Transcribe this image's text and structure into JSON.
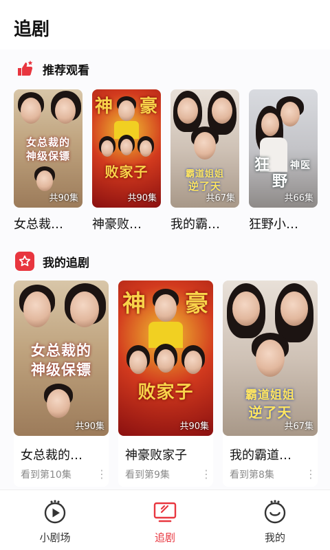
{
  "page": {
    "title": "追剧"
  },
  "recommend": {
    "title": "推荐观看",
    "items": [
      {
        "name": "女总裁…",
        "poster_title_1": "女总裁的",
        "poster_title_2": "神级保镖",
        "count": "共90集"
      },
      {
        "name": "神豪败…",
        "poster_title_1": "神",
        "poster_title_2": "豪",
        "poster_title_3": "败家子",
        "count": "共90集"
      },
      {
        "name": "我的霸…",
        "poster_title_1": "霸道姐姐",
        "poster_title_2": "逆了天",
        "count": "共67集"
      },
      {
        "name": "狂野小…",
        "poster_title_1": "狂",
        "poster_title_2": "野",
        "poster_title_3": "神医",
        "count": "共66集"
      }
    ]
  },
  "my_dramas": {
    "title": "我的追剧",
    "items": [
      {
        "name": "女总裁的…",
        "progress": "看到第10集",
        "poster_title_1": "女总裁的",
        "poster_title_2": "神级保镖",
        "count": "共90集"
      },
      {
        "name": "神豪败家子",
        "progress": "看到第9集",
        "poster_title_1": "神",
        "poster_title_2": "豪",
        "poster_title_3": "败家子",
        "count": "共90集"
      },
      {
        "name": "我的霸道…",
        "progress": "看到第8集",
        "poster_title_1": "霸道姐姐",
        "poster_title_2": "逆了天",
        "count": "共67集"
      }
    ]
  },
  "tabs": [
    {
      "label": "小剧场",
      "icon": "play-circle-icon",
      "active": false
    },
    {
      "label": "追剧",
      "icon": "tv-icon",
      "active": true
    },
    {
      "label": "我的",
      "icon": "smile-icon",
      "active": false
    }
  ],
  "colors": {
    "accent": "#e8363f",
    "inactive": "#333333"
  }
}
